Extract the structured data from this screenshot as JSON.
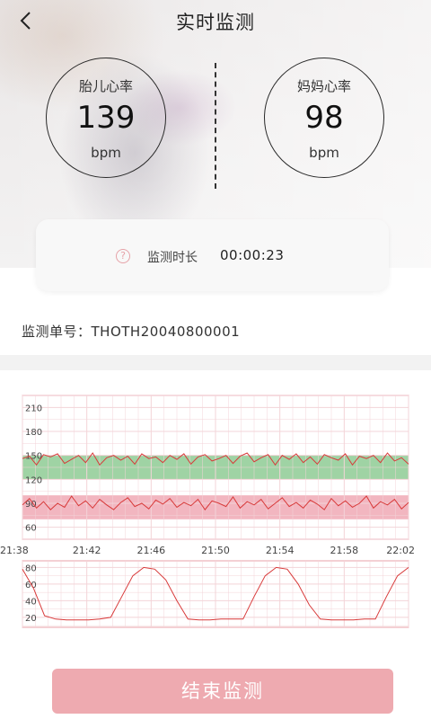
{
  "header": {
    "title": "实时监测"
  },
  "fetal_heart": {
    "label": "胎儿心率",
    "value": "139",
    "unit": "bpm"
  },
  "mother_heart": {
    "label": "妈妈心率",
    "value": "98",
    "unit": "bpm"
  },
  "duration": {
    "help_symbol": "?",
    "label": "监测时长",
    "value": "00:00:23"
  },
  "order": {
    "label": "监测单号：",
    "value": "THOTH20040800001"
  },
  "end_button": {
    "label": "结束监测"
  },
  "colors": {
    "accent_pink": "#eeaab0",
    "chart_border": "#e9a0a8",
    "grid": "#f3d4d8",
    "line": "#d83a3a",
    "band_green": "#9fd3a4",
    "band_pink": "#f2b6c0"
  },
  "chart_data": [
    {
      "type": "line",
      "title": "",
      "yticks": [
        "210",
        "180",
        "150",
        "120",
        "90",
        "60"
      ],
      "ylim": [
        45,
        225
      ],
      "x": [
        "21:38",
        "21:42",
        "21:46",
        "21:50",
        "21:54",
        "21:58",
        "22:02"
      ],
      "bands": [
        {
          "from": 120,
          "to": 150,
          "color": "green"
        },
        {
          "from": 70,
          "to": 100,
          "color": "pink"
        }
      ],
      "series": [
        {
          "values": [
            146,
            149,
            138,
            151,
            148,
            152,
            140,
            145,
            150,
            141,
            153,
            138,
            147,
            150,
            144,
            149,
            139,
            152,
            146,
            148,
            141,
            150,
            145,
            152,
            139,
            148,
            151,
            143,
            146,
            150,
            140,
            149,
            153,
            142,
            147,
            151,
            138,
            150,
            145,
            152,
            141,
            148,
            139,
            151,
            147,
            144,
            152,
            138,
            149,
            146,
            150,
            141,
            153,
            143,
            147,
            139
          ]
        },
        {
          "values": [
            88,
            96,
            84,
            92,
            82,
            90,
            85,
            99,
            87,
            93,
            84,
            95,
            88,
            82,
            91,
            97,
            86,
            90,
            83,
            94,
            89,
            96,
            85,
            91,
            87,
            95,
            82,
            93,
            90,
            86,
            98,
            84,
            92,
            88,
            95,
            83,
            90,
            97,
            86,
            91,
            84,
            94,
            89,
            82,
            96,
            87,
            93,
            85,
            90,
            99,
            84,
            92,
            88,
            95,
            83,
            91
          ]
        }
      ]
    },
    {
      "type": "line",
      "title": "",
      "yticks": [
        "80",
        "60",
        "40",
        "20"
      ],
      "ylim": [
        8,
        88
      ],
      "x": [
        "21:38",
        "21:42",
        "21:46",
        "21:50",
        "21:54",
        "21:58",
        "22:02"
      ],
      "series": [
        {
          "values": [
            78,
            55,
            22,
            18,
            17,
            17,
            17,
            18,
            20,
            45,
            70,
            80,
            78,
            65,
            40,
            18,
            17,
            17,
            18,
            18,
            18,
            45,
            70,
            80,
            78,
            60,
            35,
            18,
            17,
            17,
            17,
            18,
            18,
            45,
            70,
            80
          ]
        }
      ]
    }
  ]
}
